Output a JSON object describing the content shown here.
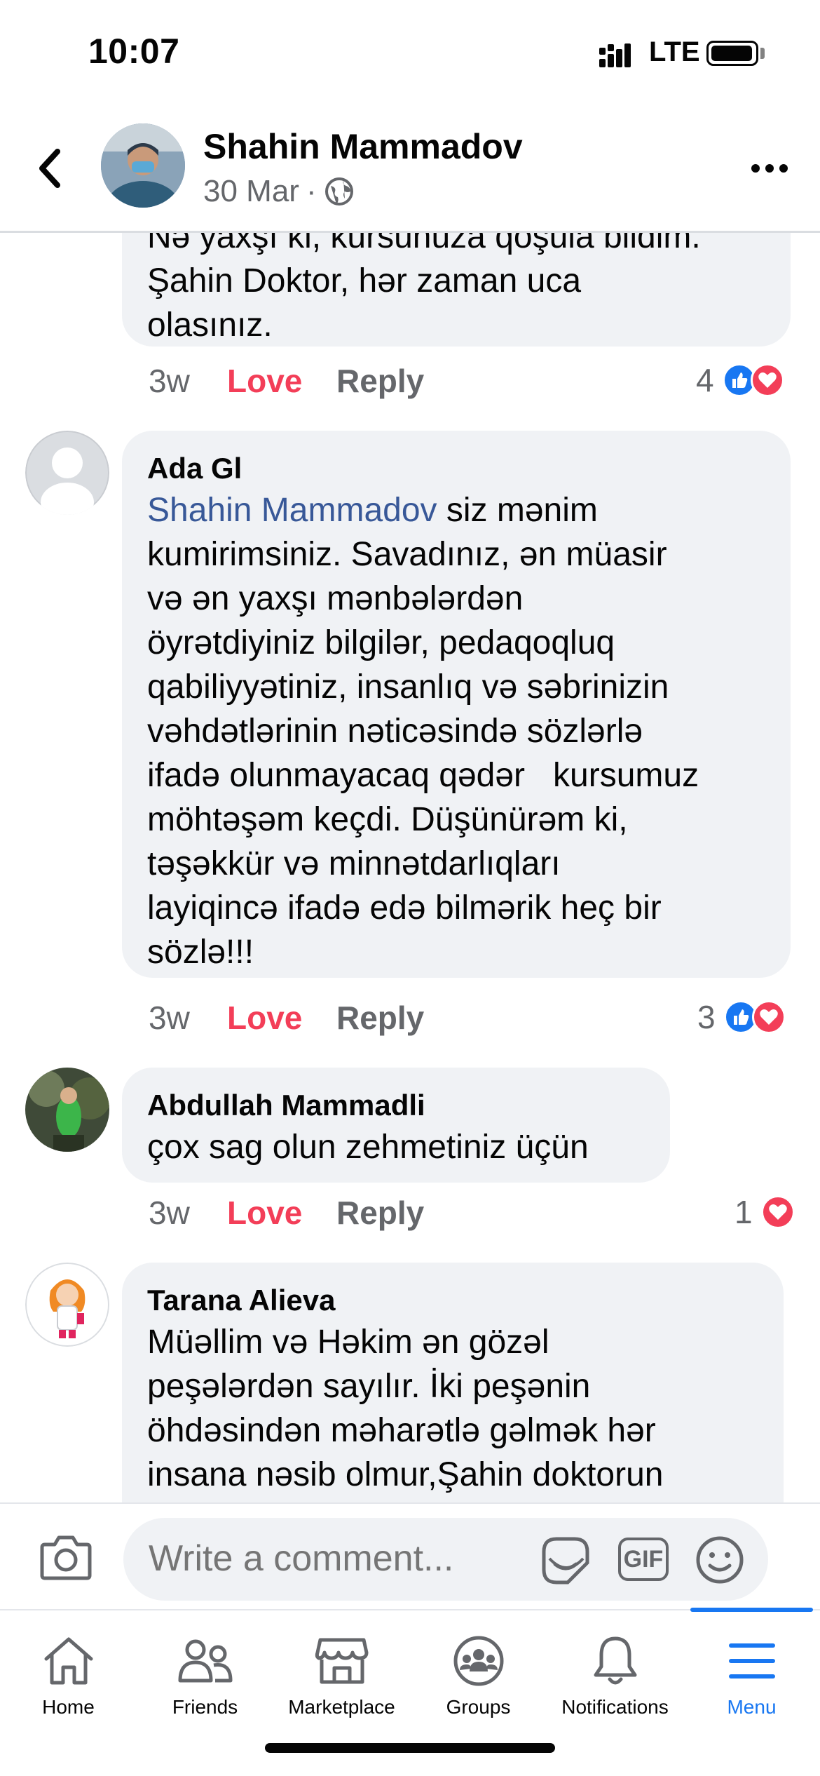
{
  "status_bar": {
    "time": "10:07",
    "network": "LTE"
  },
  "header": {
    "name": "Shahin Mammadov",
    "date": "30 Mar",
    "separator": "·",
    "icons": {
      "back": "chevron-left-icon",
      "privacy": "globe-icon",
      "more": "more-horizontal-icon"
    }
  },
  "comments": [
    {
      "name": "",
      "text": "Nə yaxşı ki, kursunuza qoşula bildim.\nŞahin Doktor, hər zaman uca\nolasınız.",
      "time": "3w",
      "love_label": "Love",
      "reply_label": "Reply",
      "reaction_count": "4",
      "reactions": [
        "like",
        "love"
      ]
    },
    {
      "name": "Ada Gl",
      "mention": "Shahin Mammadov",
      "text": " siz mənim\nkumirimsiniz. Savadınız, ən müasir\nvə ən yaxşı mənbələrdən\nöyrətdiyiniz bilgilər, pedaqoqluq\nqabiliyyətiniz, insanlıq və səbrinizin\nvəhdətlərinin nəticəsində sözlərlə\nifadə olunmayacaq qədər   kursumuz\nmöhtəşəm keçdi. Düşünürəm ki,\ntəşəkkür və minnətdarlıqları\nlayiqincə ifadə edə bilmərik heç bir\nsözlə!!!",
      "time": "3w",
      "love_label": "Love",
      "reply_label": "Reply",
      "reaction_count": "3",
      "reactions": [
        "like",
        "love"
      ]
    },
    {
      "name": "Abdullah Mammadli",
      "text": "çox sag olun zehmetiniz üçün",
      "time": "3w",
      "love_label": "Love",
      "reply_label": "Reply",
      "reaction_count": "1",
      "reactions": [
        "love"
      ]
    },
    {
      "name": "Tarana Alieva",
      "text": "Müəllim və Həkim ən gözəl\npeşələrdən sayılır. İki peşənin\nöhdəsindən məharətlə gəlmək hər\ninsana nəsib olmur,Şahin doktorun"
    }
  ],
  "composer": {
    "placeholder": "Write a comment...",
    "gif_label": "GIF",
    "icons": {
      "camera": "camera-icon",
      "sticker": "sticker-icon",
      "emoji": "emoji-icon"
    }
  },
  "tabs": [
    {
      "label": "Home",
      "icon": "home-icon",
      "active": false
    },
    {
      "label": "Friends",
      "icon": "friends-icon",
      "active": false
    },
    {
      "label": "Marketplace",
      "icon": "marketplace-icon",
      "active": false
    },
    {
      "label": "Groups",
      "icon": "groups-icon",
      "active": false
    },
    {
      "label": "Notifications",
      "icon": "bell-icon",
      "active": false
    },
    {
      "label": "Menu",
      "icon": "menu-icon",
      "active": true
    }
  ],
  "colors": {
    "accent": "#1877f2",
    "love": "#f33e58",
    "mention": "#385898",
    "bubble": "#f0f2f5",
    "secondary_text": "#65676b"
  }
}
